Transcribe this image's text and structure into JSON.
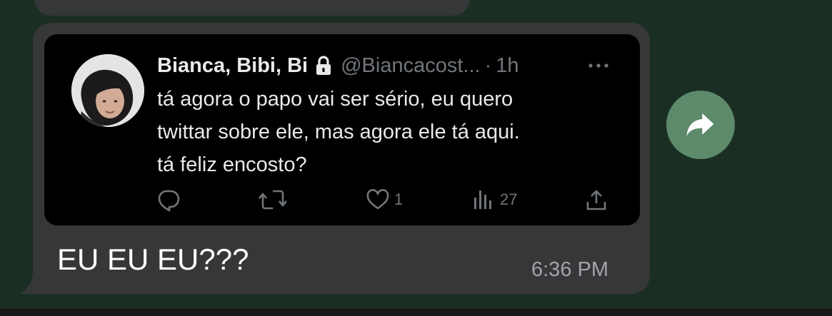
{
  "tweet": {
    "author_name": "Bianca, Bibi, Bi",
    "handle": "@Biancacost...",
    "separator": "·",
    "time_ago": "1h",
    "text_lines": [
      "tá agora o papo vai ser sério, eu quero",
      "twittar sobre ele, mas agora ele tá aqui.",
      "tá feliz encosto?"
    ],
    "actions": {
      "like_count": "1",
      "views_count": "27"
    }
  },
  "message": {
    "text": "EU EU EU???",
    "time": "6:36 PM"
  },
  "icons": {
    "lock": "lock-icon",
    "more": "more-icon",
    "reply": "reply-icon",
    "retweet": "retweet-icon",
    "like": "heart-icon",
    "views": "views-icon",
    "share": "share-icon",
    "forward": "forward-icon"
  },
  "colors": {
    "background": "#1b2e24",
    "bubble": "#363739",
    "tweet_background": "#000000",
    "tweet_text": "#e7e9ea",
    "tweet_muted": "#71767b",
    "forward_button": "#5c8a6b"
  }
}
